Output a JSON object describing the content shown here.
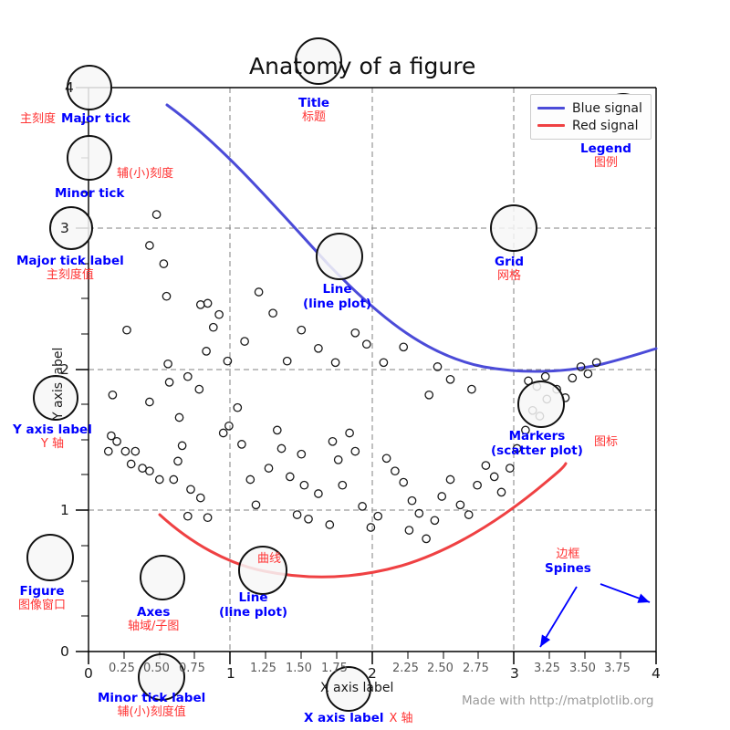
{
  "figure": {
    "title": "Anatomy of a figure",
    "watermark": "Made with http://matplotlib.org",
    "x_axis_label": "X axis label",
    "y_axis_label": "Y axis label",
    "colors": {
      "blue_line": "#4b4bd8",
      "red_line": "#ef4143",
      "annotation_en": "#0000ff",
      "annotation_cn": "#ff3333",
      "spine": "#000000",
      "grid": "#808080",
      "marker_edge": "#1a1a1a"
    }
  },
  "legend": {
    "entries": [
      {
        "label": "Blue signal",
        "color": "#4b4bd8"
      },
      {
        "label": "Red signal",
        "color": "#ef4143"
      }
    ]
  },
  "axes": {
    "x": {
      "min": 0,
      "max": 4,
      "major_ticks": [
        0,
        1,
        2,
        3,
        4
      ],
      "major_labels": [
        "0",
        "1",
        "2",
        "3",
        "4"
      ],
      "minor_ticks": [
        0.25,
        0.5,
        0.75,
        1.25,
        1.5,
        1.75,
        2.25,
        2.5,
        2.75,
        3.25,
        3.5,
        3.75
      ],
      "minor_labels": [
        "0.25",
        "0.50",
        "0.75",
        "1.25",
        "1.50",
        "1.75",
        "2.25",
        "2.50",
        "2.75",
        "3.25",
        "3.50",
        "3.75"
      ]
    },
    "y": {
      "min": 0,
      "max": 4,
      "major_ticks": [
        0,
        1,
        2,
        3,
        4
      ],
      "major_labels": [
        "0",
        "1",
        "2",
        "3",
        "4"
      ],
      "minor_ticks": [
        0.25,
        0.5,
        0.75,
        1.25,
        1.5,
        1.75,
        2.25,
        2.5,
        2.75,
        3.25,
        3.5,
        3.75
      ],
      "minor_labels": []
    },
    "grid": true,
    "grid_style": "dashed"
  },
  "annotations": [
    {
      "key": "major_tick",
      "en": "Major tick",
      "cn": "主刻度"
    },
    {
      "key": "minor_tick",
      "en": "Minor tick",
      "cn": "辅(小)刻度"
    },
    {
      "key": "major_tick_label",
      "en": "Major tick label",
      "cn": "主刻度值"
    },
    {
      "key": "minor_tick_label",
      "en": "Minor tick label",
      "cn": "辅(小)刻度值"
    },
    {
      "key": "y_axis_label",
      "en": "Y axis label",
      "cn": "Y 轴"
    },
    {
      "key": "x_axis_label",
      "en": "X axis label",
      "cn": "X 轴"
    },
    {
      "key": "title",
      "en": "Title",
      "cn": "标题"
    },
    {
      "key": "legend",
      "en": "Legend",
      "cn": "图例"
    },
    {
      "key": "grid",
      "en": "Grid",
      "cn": "网格"
    },
    {
      "key": "line_blue",
      "en": "Line\n(line plot)",
      "cn": ""
    },
    {
      "key": "line_red",
      "en": "Line\n(line plot)",
      "cn": "曲线"
    },
    {
      "key": "markers",
      "en": "Markers\n(scatter plot)",
      "cn": "图标"
    },
    {
      "key": "figure",
      "en": "Figure",
      "cn": "图像窗口"
    },
    {
      "key": "axes",
      "en": "Axes",
      "cn": "轴域/子图"
    },
    {
      "key": "spines",
      "en": "Spines",
      "cn": "边框"
    }
  ],
  "annotation_labels": {
    "major_tick_en": "Major tick",
    "major_tick_cn": "主刻度",
    "minor_tick_en": "Minor tick",
    "minor_tick_cn": "辅(小)刻度",
    "major_tick_label_en": "Major tick label",
    "major_tick_label_cn": "主刻度值",
    "minor_tick_label_en": "Minor tick label",
    "minor_tick_label_cn": "辅(小)刻度值",
    "y_axis_label_en": "Y axis label",
    "y_axis_label_cn": "Y 轴",
    "x_axis_label_en": "X axis label",
    "x_axis_label_cn": "X 轴",
    "title_en": "Title",
    "title_cn": "标题",
    "legend_en": "Legend",
    "legend_cn": "图例",
    "grid_en": "Grid",
    "grid_cn": "网格",
    "line_blue_en_1": "Line",
    "line_blue_en_2": "(line plot)",
    "line_red_en_1": "Line",
    "line_red_en_2": "(line plot)",
    "line_red_cn": "曲线",
    "markers_en_1": "Markers",
    "markers_en_2": "(scatter plot)",
    "markers_cn": "图标",
    "figure_en": "Figure",
    "figure_cn": "图像窗口",
    "axes_en": "Axes",
    "axes_cn": "轴域/子图",
    "spines_en": "Spines",
    "spines_cn": "边框"
  },
  "chart_data": {
    "type": "line",
    "title": "Anatomy of a figure",
    "xlabel": "X axis label",
    "ylabel": "Y axis label",
    "xlim": [
      0,
      4
    ],
    "ylim": [
      0,
      4
    ],
    "grid": true,
    "legend_position": "upper right",
    "series": [
      {
        "name": "Blue signal",
        "type": "line",
        "color": "#4b4bd8",
        "x": [
          0.55,
          0.8,
          1.05,
          1.3,
          1.55,
          1.8,
          2.05,
          2.3,
          2.55,
          2.8,
          3.05,
          3.3,
          3.55,
          3.8,
          4.0
        ],
        "y": [
          3.72,
          3.56,
          3.35,
          3.1,
          2.86,
          2.62,
          2.42,
          2.26,
          2.14,
          2.05,
          2.0,
          2.0,
          2.03,
          2.07,
          2.11
        ]
      },
      {
        "name": "Red signal",
        "type": "line",
        "color": "#ef4143",
        "x": [
          0.5,
          0.75,
          1.0,
          1.25,
          1.5,
          1.75,
          2.0,
          2.25,
          2.5,
          2.75,
          3.0,
          3.25,
          3.5
        ],
        "y": [
          0.97,
          0.77,
          0.62,
          0.52,
          0.48,
          0.48,
          0.52,
          0.6,
          0.72,
          0.88,
          1.07,
          1.26,
          1.42
        ]
      },
      {
        "name": "Scatter markers",
        "type": "scatter",
        "marker": "o",
        "filled": false,
        "edge_color": "#1a1a1a",
        "points": [
          [
            0.48,
            3.1
          ],
          [
            0.43,
            2.88
          ],
          [
            0.53,
            2.75
          ],
          [
            0.55,
            2.52
          ],
          [
            0.27,
            2.28
          ],
          [
            0.79,
            2.46
          ],
          [
            0.84,
            2.47
          ],
          [
            0.92,
            2.39
          ],
          [
            0.88,
            2.3
          ],
          [
            0.83,
            2.13
          ],
          [
            0.7,
            1.95
          ],
          [
            0.78,
            1.86
          ],
          [
            0.57,
            1.91
          ],
          [
            0.17,
            1.82
          ],
          [
            0.43,
            1.77
          ],
          [
            0.64,
            1.66
          ],
          [
            0.16,
            1.53
          ],
          [
            0.2,
            1.49
          ],
          [
            0.14,
            1.42
          ],
          [
            0.26,
            1.42
          ],
          [
            0.33,
            1.42
          ],
          [
            0.3,
            1.33
          ],
          [
            0.38,
            1.3
          ],
          [
            0.43,
            1.28
          ],
          [
            0.5,
            1.22
          ],
          [
            0.6,
            1.22
          ],
          [
            0.63,
            1.35
          ],
          [
            0.66,
            1.46
          ],
          [
            0.72,
            1.15
          ],
          [
            0.79,
            1.09
          ],
          [
            0.7,
            0.96
          ],
          [
            0.84,
            0.95
          ],
          [
            0.99,
            1.6
          ],
          [
            0.95,
            1.55
          ],
          [
            1.05,
            1.73
          ],
          [
            1.08,
            1.47
          ],
          [
            1.14,
            1.22
          ],
          [
            1.18,
            1.04
          ],
          [
            1.27,
            1.3
          ],
          [
            1.33,
            1.57
          ],
          [
            1.36,
            1.44
          ],
          [
            1.42,
            1.24
          ],
          [
            1.5,
            1.4
          ],
          [
            1.52,
            1.18
          ],
          [
            1.47,
            0.97
          ],
          [
            1.55,
            0.94
          ],
          [
            1.62,
            1.12
          ],
          [
            1.7,
            0.9
          ],
          [
            1.72,
            1.49
          ],
          [
            1.76,
            1.36
          ],
          [
            1.84,
            1.55
          ],
          [
            1.88,
            1.42
          ],
          [
            1.79,
            1.18
          ],
          [
            1.93,
            1.03
          ],
          [
            1.99,
            0.88
          ],
          [
            2.04,
            0.96
          ],
          [
            2.1,
            1.37
          ],
          [
            2.16,
            1.28
          ],
          [
            2.22,
            1.2
          ],
          [
            2.28,
            1.07
          ],
          [
            2.33,
            0.98
          ],
          [
            2.26,
            0.86
          ],
          [
            2.38,
            0.8
          ],
          [
            2.44,
            0.93
          ],
          [
            2.49,
            1.1
          ],
          [
            2.55,
            1.22
          ],
          [
            2.62,
            1.04
          ],
          [
            2.68,
            0.97
          ],
          [
            2.74,
            1.18
          ],
          [
            2.8,
            1.32
          ],
          [
            2.86,
            1.24
          ],
          [
            2.91,
            1.13
          ],
          [
            2.97,
            1.3
          ],
          [
            3.02,
            1.44
          ],
          [
            3.08,
            1.57
          ],
          [
            3.13,
            1.71
          ],
          [
            3.18,
            1.67
          ],
          [
            3.23,
            1.79
          ],
          [
            3.3,
            1.86
          ],
          [
            3.36,
            1.8
          ],
          [
            3.41,
            1.94
          ],
          [
            3.47,
            2.02
          ],
          [
            3.52,
            1.97
          ],
          [
            3.58,
            2.05
          ],
          [
            3.1,
            1.92
          ],
          [
            3.16,
            1.88
          ],
          [
            3.22,
            1.95
          ],
          [
            2.7,
            1.86
          ],
          [
            2.55,
            1.93
          ],
          [
            2.46,
            2.02
          ],
          [
            2.4,
            1.82
          ],
          [
            2.22,
            2.16
          ],
          [
            2.08,
            2.05
          ],
          [
            1.96,
            2.18
          ],
          [
            1.88,
            2.26
          ],
          [
            1.74,
            2.05
          ],
          [
            1.62,
            2.15
          ],
          [
            1.5,
            2.28
          ],
          [
            1.4,
            2.06
          ],
          [
            1.3,
            2.4
          ],
          [
            1.2,
            2.55
          ],
          [
            1.1,
            2.2
          ],
          [
            0.98,
            2.06
          ],
          [
            0.56,
            2.04
          ]
        ]
      }
    ]
  }
}
